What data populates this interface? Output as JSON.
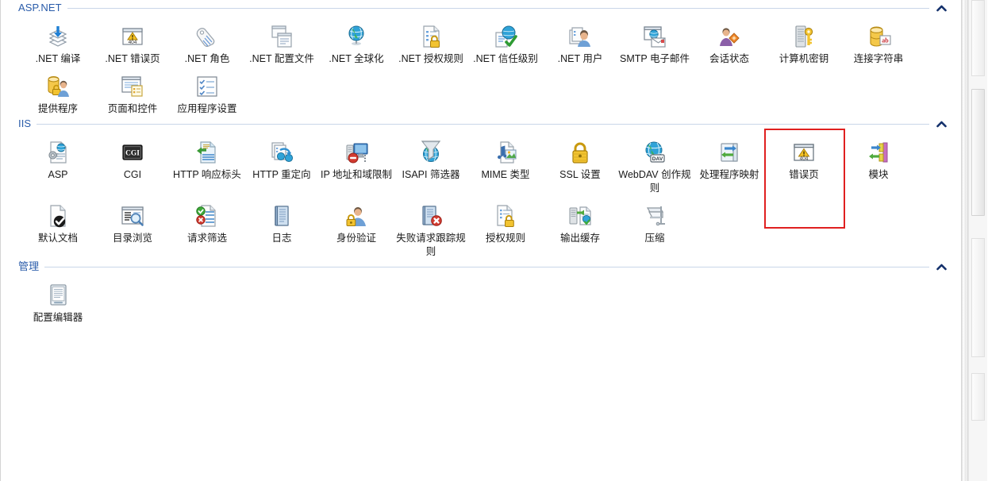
{
  "colors": {
    "group_title": "#2a5caa",
    "rule": "#c9d6e8",
    "chevron": "#13306b",
    "highlight": "#e02020",
    "label_text": "#1a1a1a",
    "pane_bg": "#ffffff"
  },
  "sections": [
    {
      "id": "aspnet",
      "title": "ASP.NET",
      "collapse_state": "expanded",
      "items": [
        {
          "label": ".NET 编译",
          "icon": "net-compilation-icon"
        },
        {
          "label": ".NET 错误页",
          "icon": "net-error-pages-404-icon"
        },
        {
          "label": ".NET 角色",
          "icon": "net-roles-tag-icon"
        },
        {
          "label": ".NET 配置文件",
          "icon": "net-profile-icon"
        },
        {
          "label": ".NET 全球化",
          "icon": "net-globalization-globe-icon"
        },
        {
          "label": ".NET 授权规则",
          "icon": "net-authorization-rules-lock-icon"
        },
        {
          "label": ".NET 信任级别",
          "icon": "net-trust-levels-check-icon"
        },
        {
          "label": ".NET 用户",
          "icon": "net-users-person-icon"
        },
        {
          "label": "SMTP 电子邮件",
          "icon": "smtp-email-icon"
        },
        {
          "label": "会话状态",
          "icon": "session-state-icon"
        },
        {
          "label": "计算机密钥",
          "icon": "machine-key-server-icon"
        },
        {
          "label": "连接字符串",
          "icon": "connection-strings-db-icon"
        },
        {
          "label": "提供程序",
          "icon": "providers-db-user-icon"
        },
        {
          "label": "页面和控件",
          "icon": "pages-and-controls-icon"
        },
        {
          "label": "应用程序设置",
          "icon": "application-settings-icon"
        }
      ]
    },
    {
      "id": "iis",
      "title": "IIS",
      "collapse_state": "expanded",
      "items": [
        {
          "label": "ASP",
          "icon": "asp-gear-page-icon"
        },
        {
          "label": "CGI",
          "icon": "cgi-black-box-icon"
        },
        {
          "label": "HTTP 响应标头",
          "icon": "http-response-headers-icon"
        },
        {
          "label": "HTTP 重定向",
          "icon": "http-redirect-icon"
        },
        {
          "label": "IP 地址和域限制",
          "icon": "ip-address-domain-restrictions-icon"
        },
        {
          "label": "ISAPI 筛选器",
          "icon": "isapi-filters-funnel-icon"
        },
        {
          "label": "MIME 类型",
          "icon": "mime-types-icon"
        },
        {
          "label": "SSL 设置",
          "icon": "ssl-settings-padlock-icon"
        },
        {
          "label": "WebDAV 创作规则",
          "icon": "webdav-authoring-rules-icon"
        },
        {
          "label": "处理程序映射",
          "icon": "handler-mappings-icon"
        },
        {
          "label": "错误页",
          "icon": "error-pages-404-icon",
          "highlighted": true
        },
        {
          "label": "模块",
          "icon": "modules-icon"
        },
        {
          "label": "默认文档",
          "icon": "default-document-icon"
        },
        {
          "label": "目录浏览",
          "icon": "directory-browsing-icon"
        },
        {
          "label": "请求筛选",
          "icon": "request-filtering-icon"
        },
        {
          "label": "日志",
          "icon": "logging-book-icon"
        },
        {
          "label": "身份验证",
          "icon": "authentication-icon"
        },
        {
          "label": "失败请求跟踪规则",
          "icon": "failed-request-tracing-rules-icon"
        },
        {
          "label": "授权规则",
          "icon": "authorization-rules-icon"
        },
        {
          "label": "输出缓存",
          "icon": "output-caching-icon"
        },
        {
          "label": "压缩",
          "icon": "compression-icon"
        }
      ]
    },
    {
      "id": "management",
      "title": "管理",
      "collapse_state": "expanded",
      "items": [
        {
          "label": "配置编辑器",
          "icon": "configuration-editor-icon"
        }
      ]
    }
  ],
  "scrollbar": {
    "orientation": "vertical",
    "thumb_position": "upper-middle"
  }
}
